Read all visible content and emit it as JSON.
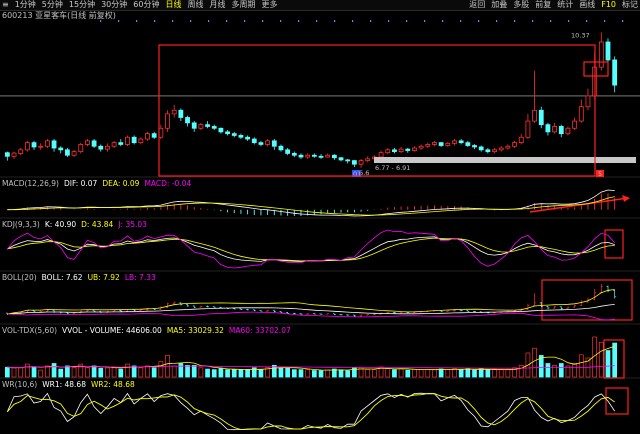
{
  "toolbar": {
    "tabs": [
      "1分钟",
      "5分钟",
      "15分钟",
      "30分钟",
      "60分钟",
      "日线",
      "周线",
      "月线",
      "多周期",
      "更多"
    ],
    "active_tab": "日线",
    "right_buttons": [
      "返回",
      "加叠",
      "多股",
      "前复",
      "统计",
      "画线",
      "F10",
      "标记"
    ],
    "first_glyph": "≡"
  },
  "stock": {
    "code": "600213",
    "name": "亚星客车(日线 前复权)"
  },
  "price_chart": {
    "high_label": "10.37",
    "low_label": "6.6",
    "range_label": "6.77 - 6.91",
    "markers": {
      "day_marker": "01",
      "tag_5": "5"
    }
  },
  "indicators": {
    "macd": {
      "name": "MACD(12,26,9)",
      "dif": "DIF: 0.07",
      "dea": "DEA: 0.09",
      "macd": "MACD: -0.04",
      "colors": {
        "dif": "#ffffff",
        "dea": "#ffff00",
        "macd": "#ff00ff"
      }
    },
    "kdj": {
      "name": "KDJ(9,3,3)",
      "k": "K: 40.90",
      "d": "D: 43.84",
      "j": "J: 35.03",
      "colors": {
        "k": "#ffffff",
        "d": "#ffff00",
        "j": "#ff00ff"
      }
    },
    "boll": {
      "name": "BOLL(20)",
      "boll": "BOLL: 7.62",
      "ub": "UB: 7.92",
      "lb": "LB: 7.33",
      "colors": {
        "boll": "#ffffff",
        "ub": "#ffff00",
        "lb": "#ff00ff"
      }
    },
    "vol": {
      "name": "VOL-TDX(5,60)",
      "vvol": "VVOL - VOLUME: 44606.00",
      "ma5": "MA5: 33029.32",
      "ma60": "MA60: 33702.07",
      "colors": {
        "vvol": "#ffffff",
        "ma5": "#ffff00",
        "ma60": "#ff00ff"
      }
    },
    "wr": {
      "name": "WR(10,6)",
      "wr1": "WR1: 48.68",
      "wr2": "WR2: 48.68",
      "colors": {
        "wr1": "#ffffff",
        "wr2": "#ffff00"
      }
    }
  },
  "colors": {
    "up": "#ff3030",
    "down": "#54ffff",
    "annotation": "#ff2020",
    "yellow": "#ffff00",
    "magenta": "#ff00ff"
  },
  "chart_data": {
    "type": "candlestick",
    "candles": [
      [
        7.02,
        6.92,
        7.05,
        6.8
      ],
      [
        6.92,
        7.01,
        7.05,
        6.85
      ],
      [
        7.0,
        7.1,
        7.15,
        6.95
      ],
      [
        7.1,
        7.3,
        7.35,
        7.05
      ],
      [
        7.3,
        7.18,
        7.35,
        7.1
      ],
      [
        7.18,
        7.2,
        7.28,
        7.1
      ],
      [
        7.2,
        7.35,
        7.4,
        7.15
      ],
      [
        7.35,
        7.15,
        7.4,
        7.05
      ],
      [
        7.15,
        7.1,
        7.2,
        7.0
      ],
      [
        7.1,
        6.95,
        7.15,
        6.9
      ],
      [
        6.95,
        7.05,
        7.1,
        6.9
      ],
      [
        7.05,
        7.25,
        7.3,
        7.0
      ],
      [
        7.25,
        7.35,
        7.4,
        7.2
      ],
      [
        7.35,
        7.2,
        7.4,
        7.15
      ],
      [
        7.2,
        7.12,
        7.25,
        7.05
      ],
      [
        7.12,
        7.2,
        7.28,
        7.05
      ],
      [
        7.2,
        7.3,
        7.35,
        7.15
      ],
      [
        7.3,
        7.25,
        7.4,
        7.2
      ],
      [
        7.25,
        7.45,
        7.5,
        7.2
      ],
      [
        7.45,
        7.3,
        7.5,
        7.25
      ],
      [
        7.3,
        7.4,
        7.45,
        7.25
      ],
      [
        7.4,
        7.55,
        7.6,
        7.35
      ],
      [
        7.55,
        7.45,
        7.6,
        7.4
      ],
      [
        7.45,
        7.7,
        7.8,
        7.4
      ],
      [
        7.7,
        8.1,
        8.2,
        7.6
      ],
      [
        8.1,
        8.2,
        8.35,
        8.0
      ],
      [
        8.2,
        8.0,
        8.25,
        7.9
      ],
      [
        8.0,
        7.85,
        8.05,
        7.75
      ],
      [
        7.85,
        7.7,
        7.9,
        7.6
      ],
      [
        7.7,
        7.8,
        7.85,
        7.65
      ],
      [
        7.8,
        7.75,
        7.9,
        7.7
      ],
      [
        7.75,
        7.7,
        7.8,
        7.65
      ],
      [
        7.7,
        7.6,
        7.72,
        7.55
      ],
      [
        7.6,
        7.55,
        7.65,
        7.5
      ],
      [
        7.55,
        7.5,
        7.6,
        7.45
      ],
      [
        7.5,
        7.45,
        7.55,
        7.4
      ],
      [
        7.45,
        7.4,
        7.5,
        7.35
      ],
      [
        7.4,
        7.3,
        7.45,
        7.25
      ],
      [
        7.3,
        7.25,
        7.35,
        7.2
      ],
      [
        7.25,
        7.35,
        7.4,
        7.2
      ],
      [
        7.35,
        7.2,
        7.4,
        7.1
      ],
      [
        7.2,
        7.1,
        7.25,
        7.05
      ],
      [
        7.1,
        7.0,
        7.15,
        6.95
      ],
      [
        7.0,
        6.95,
        7.05,
        6.9
      ],
      [
        6.95,
        6.9,
        7.0,
        6.85
      ],
      [
        6.9,
        6.95,
        7.0,
        6.85
      ],
      [
        6.95,
        6.92,
        7.0,
        6.88
      ],
      [
        6.92,
        6.9,
        6.98,
        6.85
      ],
      [
        6.9,
        6.95,
        7.0,
        6.88
      ],
      [
        6.95,
        6.88,
        6.98,
        6.82
      ],
      [
        6.88,
        6.82,
        6.9,
        6.78
      ],
      [
        6.82,
        6.8,
        6.85,
        6.72
      ],
      [
        6.8,
        6.7,
        6.82,
        6.62
      ],
      [
        6.7,
        6.8,
        6.85,
        6.6
      ],
      [
        6.8,
        6.85,
        6.92,
        6.75
      ],
      [
        6.85,
        6.9,
        6.95,
        6.8
      ],
      [
        6.9,
        7.02,
        7.08,
        6.85
      ],
      [
        7.02,
        7.1,
        7.15,
        6.98
      ],
      [
        7.1,
        7.05,
        7.15,
        7.0
      ],
      [
        7.05,
        7.12,
        7.18,
        7.0
      ],
      [
        7.12,
        7.08,
        7.15,
        7.02
      ],
      [
        7.08,
        7.15,
        7.2,
        7.05
      ],
      [
        7.15,
        7.2,
        7.25,
        7.1
      ],
      [
        7.2,
        7.25,
        7.3,
        7.15
      ],
      [
        7.25,
        7.3,
        7.35,
        7.2
      ],
      [
        7.3,
        7.22,
        7.32,
        7.18
      ],
      [
        7.22,
        7.28,
        7.32,
        7.18
      ],
      [
        7.28,
        7.35,
        7.4,
        7.22
      ],
      [
        7.35,
        7.3,
        7.4,
        7.25
      ],
      [
        7.3,
        7.22,
        7.35,
        7.18
      ],
      [
        7.22,
        7.18,
        7.26,
        7.12
      ],
      [
        7.18,
        7.1,
        7.22,
        7.05
      ],
      [
        7.1,
        7.05,
        7.15,
        7.0
      ],
      [
        7.05,
        7.1,
        7.15,
        7.0
      ],
      [
        7.1,
        7.15,
        7.2,
        7.05
      ],
      [
        7.15,
        7.2,
        7.25,
        7.1
      ],
      [
        7.2,
        7.3,
        7.35,
        7.15
      ],
      [
        7.3,
        7.45,
        7.55,
        7.25
      ],
      [
        7.45,
        7.9,
        8.1,
        7.4
      ],
      [
        7.9,
        8.2,
        9.3,
        7.85
      ],
      [
        8.2,
        7.8,
        8.3,
        7.7
      ],
      [
        7.8,
        7.6,
        7.85,
        7.5
      ],
      [
        7.6,
        7.75,
        7.85,
        7.55
      ],
      [
        7.75,
        7.55,
        7.8,
        7.45
      ],
      [
        7.55,
        7.7,
        7.75,
        7.5
      ],
      [
        7.7,
        7.9,
        8.0,
        7.65
      ],
      [
        7.9,
        8.3,
        8.5,
        7.85
      ],
      [
        8.3,
        8.6,
        8.8,
        8.2
      ],
      [
        8.6,
        9.4,
        9.8,
        8.5
      ],
      [
        9.4,
        10.1,
        10.37,
        9.3
      ],
      [
        10.1,
        9.6,
        10.2,
        9.4
      ],
      [
        9.6,
        8.9,
        9.7,
        8.7
      ]
    ],
    "ylim": [
      6.4,
      10.6
    ],
    "reference_price": 8.6
  }
}
